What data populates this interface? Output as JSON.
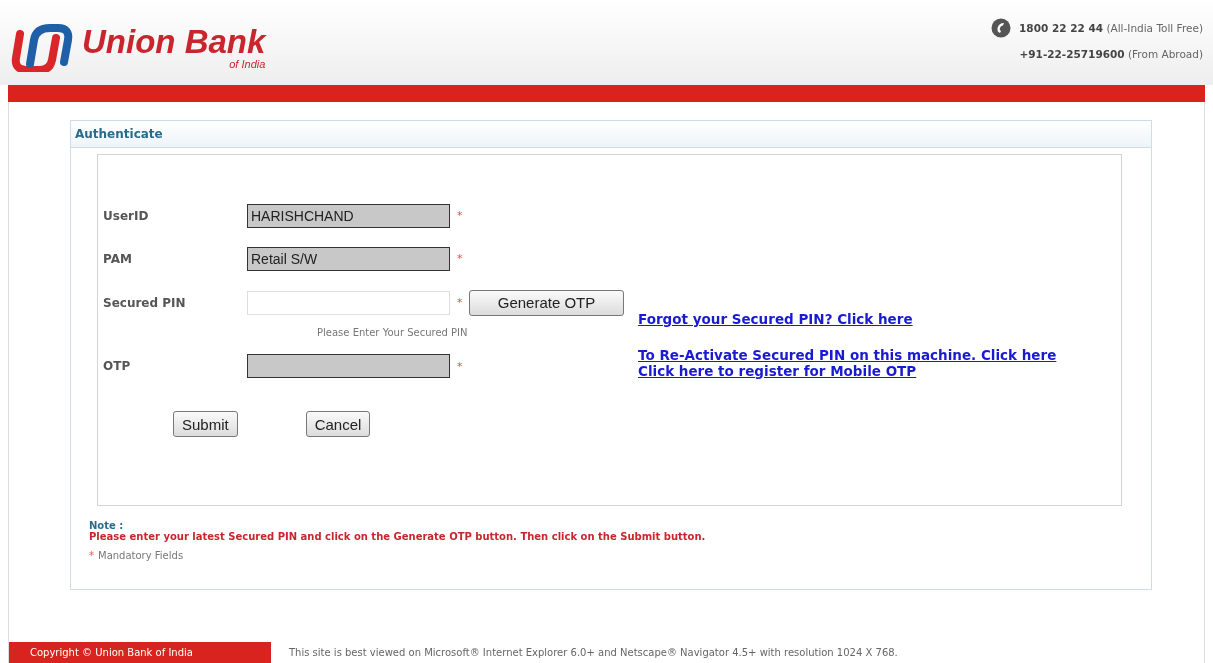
{
  "header": {
    "brand": "Union Bank",
    "brand_sub": "of India",
    "phones": [
      {
        "number": "1800 22 22 44",
        "note": "(All-India Toll Free)"
      },
      {
        "number": "+91-22-25719600",
        "note": "(From Abroad)"
      }
    ]
  },
  "panel": {
    "title": "Authenticate",
    "fields": [
      {
        "label": "UserID",
        "value": "HARISHCHAND",
        "disabled": true,
        "required_mark": "*"
      },
      {
        "label": "PAM",
        "value": "Retail S/W",
        "disabled": true,
        "required_mark": "*"
      },
      {
        "label": "Secured PIN",
        "disabled": false,
        "required_mark": "*",
        "button": "Generate OTP",
        "hint": "Please Enter Your Secured PIN"
      },
      {
        "label": "OTP",
        "disabled": true,
        "required_mark": "*"
      }
    ],
    "links": [
      "Forgot your Secured PIN? Click here",
      "To Re-Activate Secured PIN on this machine. Click here",
      "Click here to register for Mobile OTP"
    ],
    "buttons": [
      "Submit",
      "Cancel"
    ],
    "note_title": "Note :",
    "note": "Please enter your latest Secured PIN and click on the Generate OTP button. Then click on the Submit button.",
    "mandatory": {
      "mark": "*",
      "text": "Mandatory Fields"
    }
  },
  "footer": {
    "copyright": "Copyright © Union Bank of India",
    "browser_note": "This site is best viewed on Microsoft® Internet Explorer 6.0+ and Netscape® Navigator 4.5+ with resolution 1024 X 768."
  }
}
